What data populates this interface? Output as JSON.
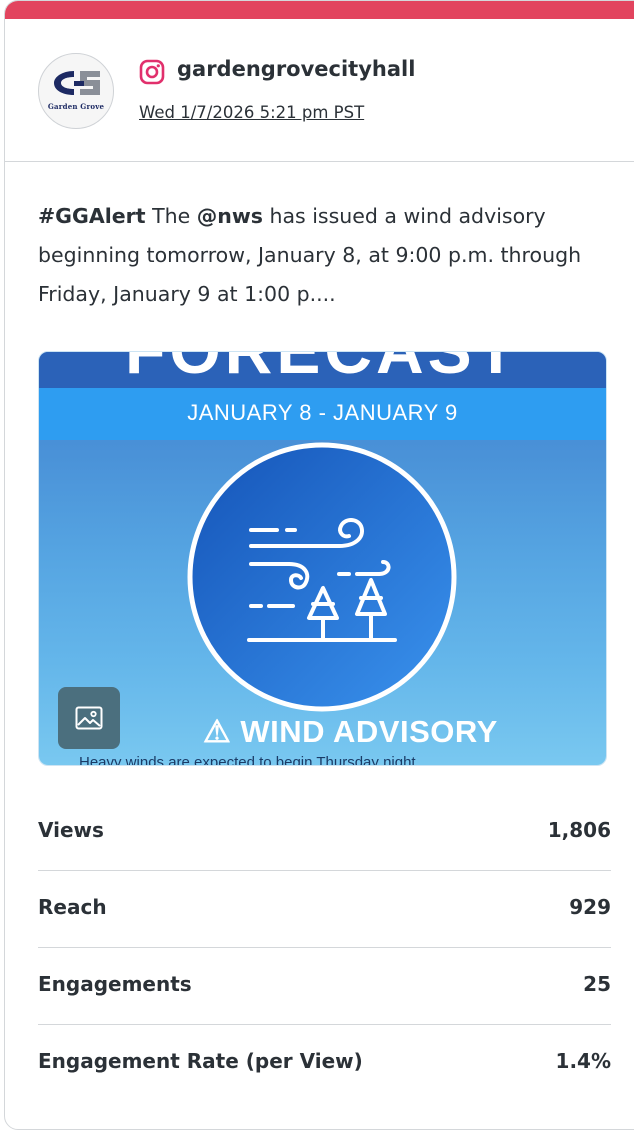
{
  "post": {
    "account": {
      "handle": "gardengrovecityhall",
      "avatar_text": "Garden Grove",
      "platform_icon": "instagram-icon"
    },
    "timestamp": "Wed 1/7/2026 5:21 pm PST",
    "caption": {
      "hashtag": "#GGAlert",
      "text_1": " The ",
      "mention": "@nws",
      "text_2": " has issued a wind advisory beginning tomorrow, January 8, at 9:00 p.m. through Friday, January 9 at 1:00 p...."
    },
    "media": {
      "heading_partial": "FORECAST",
      "dates": "JANUARY 8 - JANUARY 9",
      "icon": "wind-trees-icon",
      "advisory": "WIND ADVISORY",
      "subtext": "Heavy winds are expected to begin Thursday night",
      "badge_icon": "image-icon"
    }
  },
  "metrics": [
    {
      "label": "Views",
      "value": "1,806"
    },
    {
      "label": "Reach",
      "value": "929"
    },
    {
      "label": "Engagements",
      "value": "25"
    },
    {
      "label": "Engagement Rate (per View)",
      "value": "1.4%"
    }
  ],
  "colors": {
    "accent_bar": "#e2445e",
    "instagram": "#e1306c",
    "media_circle": "#1f6ed4",
    "badge": "#4b6f7e"
  }
}
